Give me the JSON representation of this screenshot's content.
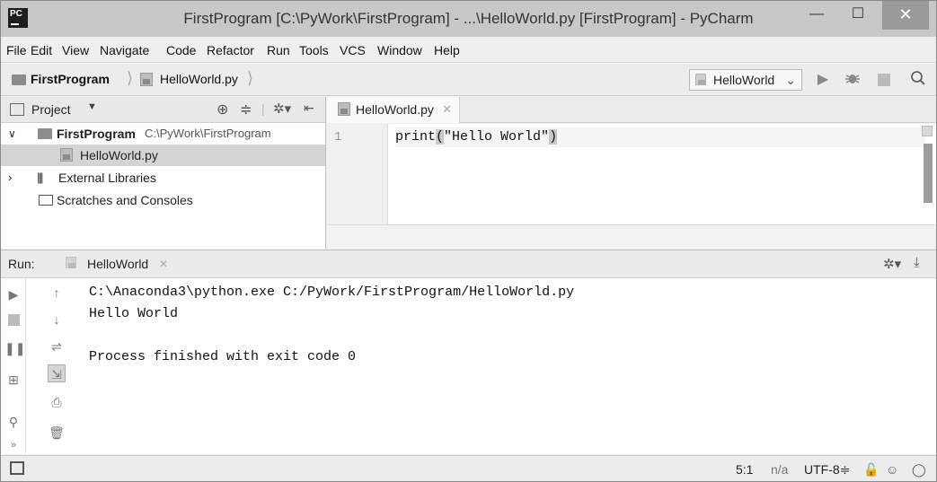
{
  "window": {
    "title": "FirstProgram [C:\\PyWork\\FirstProgram] - ...\\HelloWorld.py [FirstProgram] - PyCharm",
    "app_icon_text": "PC",
    "minimize_glyph": "—",
    "maximize_glyph": "☐",
    "close_glyph": "✕"
  },
  "menu": [
    {
      "label": "File"
    },
    {
      "label": "Edit"
    },
    {
      "label": "View"
    },
    {
      "label": "Navigate"
    },
    {
      "label": "Code"
    },
    {
      "label": "Refactor"
    },
    {
      "label": "Run"
    },
    {
      "label": "Tools"
    },
    {
      "label": "VCS"
    },
    {
      "label": "Window"
    },
    {
      "label": "Help"
    }
  ],
  "navbar": {
    "project": "FirstProgram",
    "file": "HelloWorld.py",
    "run_config": "HelloWorld"
  },
  "project_panel": {
    "title": "Project",
    "root_name": "FirstProgram",
    "root_path": "C:\\PyWork\\FirstProgram",
    "file": "HelloWorld.py",
    "external": "External Libraries",
    "scratches": "Scratches and Consoles"
  },
  "editor": {
    "tab": "HelloWorld.py",
    "line_number": "1",
    "code_func": "print",
    "code_open": "(",
    "code_arg": "\"Hello World\"",
    "code_close": ")"
  },
  "run_panel": {
    "label": "Run:",
    "tab": "HelloWorld",
    "console": [
      "C:\\Anaconda3\\python.exe C:/PyWork/FirstProgram/HelloWorld.py",
      "Hello World",
      "",
      "Process finished with exit code 0"
    ]
  },
  "status": {
    "position": "5:1",
    "separator": "n/a",
    "encoding": "UTF-8≑"
  },
  "colors": {
    "title_bg": "#c8c8c8",
    "selection": "#d4d4d4",
    "close_btn": "#9a9a9a"
  }
}
